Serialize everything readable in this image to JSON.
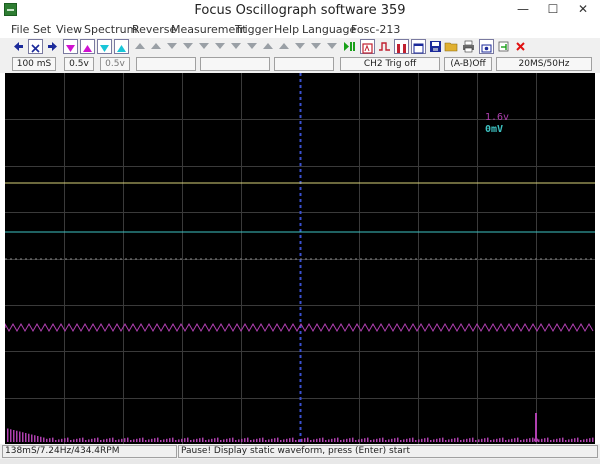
{
  "window": {
    "title": "Focus Oscillograph software 359",
    "controls": {
      "minimize": "—",
      "maximize": "☐",
      "close": "✕"
    }
  },
  "menu": [
    "File",
    "Set",
    "View",
    "Spectrum",
    "Reverse",
    "Measurement",
    "Trigger",
    "Help",
    "Language",
    "Fosc-213"
  ],
  "toolbar": {
    "icons": [
      "arrow-left-icon",
      "cross-icon",
      "arrow-right-icon",
      "triangle-down-magenta-icon",
      "triangle-up-magenta-icon",
      "triangle-down-cyan-icon",
      "triangle-up-cyan-icon",
      "play-pause-icon",
      "spectrum-icon",
      "trigger-icon",
      "channels-icon",
      "window-icon",
      "save-icon",
      "open-folder-icon",
      "print-icon",
      "settings-icon",
      "close-icon"
    ]
  },
  "status": {
    "timebase": "100 mS",
    "ch1_volts": "0.5v",
    "ch2_volts": "0.5v",
    "trigger": "CH2 Trig off",
    "math": "(A-B)Off",
    "sample_rate": "20MS/50Hz"
  },
  "scope": {
    "ch_label_magenta": "1.6v",
    "ch_label_cyan": "0mV",
    "colors": {
      "background": "#000000",
      "grid": "#3a3a3a",
      "center_axis": "#3a50d0",
      "yellow": "#d9d27a",
      "cyan": "#3ec3c3",
      "magenta": "#b040b0",
      "gray": "#8a8a8a"
    }
  },
  "footer": {
    "measurement": "138mS/7.24Hz/434.4RPM",
    "message": "Pause! Display static waveform, press (Enter) start"
  }
}
